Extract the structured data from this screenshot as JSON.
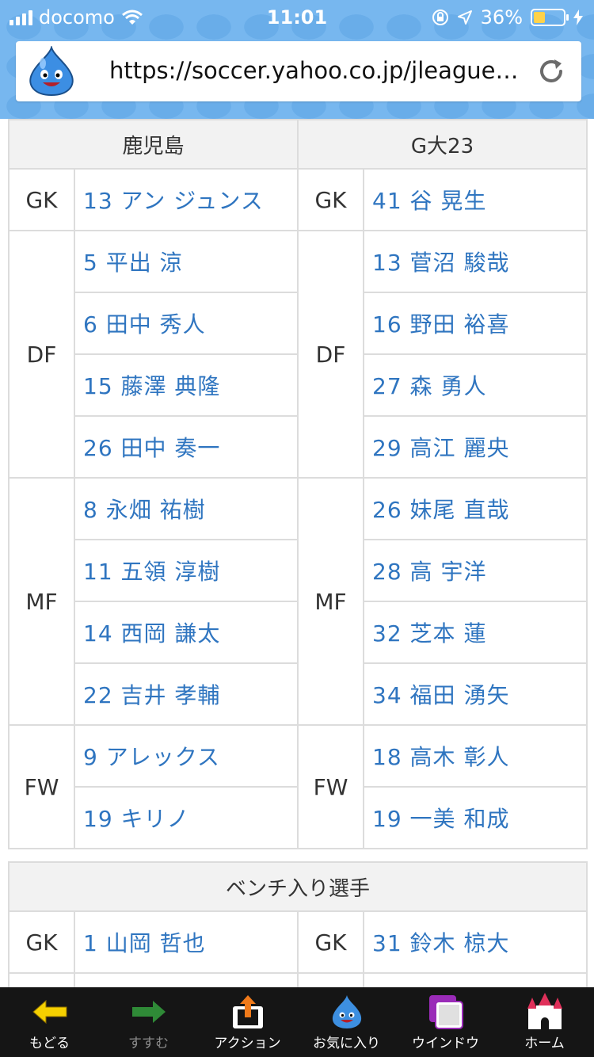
{
  "status_bar": {
    "carrier": "docomo",
    "time": "11:01",
    "battery_text": "36%",
    "battery_level": 0.36
  },
  "browser": {
    "url": "https://soccer.yahoo.co.jp/jleague/g…",
    "favicon": "slime-icon",
    "reload_icon": "reload-icon"
  },
  "lineup": {
    "home_team": "鹿児島",
    "away_team": "G大23",
    "groups": [
      {
        "position": "GK",
        "home": [
          "13 アン ジュンス"
        ],
        "away": [
          "41 谷 晃生"
        ]
      },
      {
        "position": "DF",
        "home": [
          "5 平出 涼",
          "6 田中 秀人",
          "15 藤澤 典隆",
          "26 田中 奏一"
        ],
        "away": [
          "13 菅沼 駿哉",
          "16 野田 裕喜",
          "27 森 勇人",
          "29 高江 麗央"
        ]
      },
      {
        "position": "MF",
        "home": [
          "8 永畑 祐樹",
          "11 五領 淳樹",
          "14 西岡 謙太",
          "22 吉井 孝輔"
        ],
        "away": [
          "26 妹尾 直哉",
          "28 高 宇洋",
          "32 芝本 蓮",
          "34 福田 湧矢"
        ]
      },
      {
        "position": "FW",
        "home": [
          "9 アレックス",
          "19 キリノ"
        ],
        "away": [
          "18 高木 彰人",
          "19 一美 和成"
        ]
      }
    ]
  },
  "bench": {
    "title": "ベンチ入り選手",
    "rows": [
      {
        "home_pos": "GK",
        "home": "1 山岡 哲也",
        "away_pos": "GK",
        "away": "31 鈴木 椋大"
      }
    ]
  },
  "toolbar": {
    "items": [
      {
        "label": "もどる",
        "icon": "back-arrow-icon",
        "color": "#f5d000"
      },
      {
        "label": "すすむ",
        "icon": "forward-arrow-icon",
        "color": "#2f9a3a"
      },
      {
        "label": "アクション",
        "icon": "share-icon",
        "color": "#f07a1a"
      },
      {
        "label": "お気に入り",
        "icon": "slime-icon",
        "color": "#3d8fe0"
      },
      {
        "label": "ウインドウ",
        "icon": "windows-icon",
        "color": "#9a2bb8"
      },
      {
        "label": "ホーム",
        "icon": "castle-home-icon",
        "color": "#e0305a"
      }
    ]
  }
}
